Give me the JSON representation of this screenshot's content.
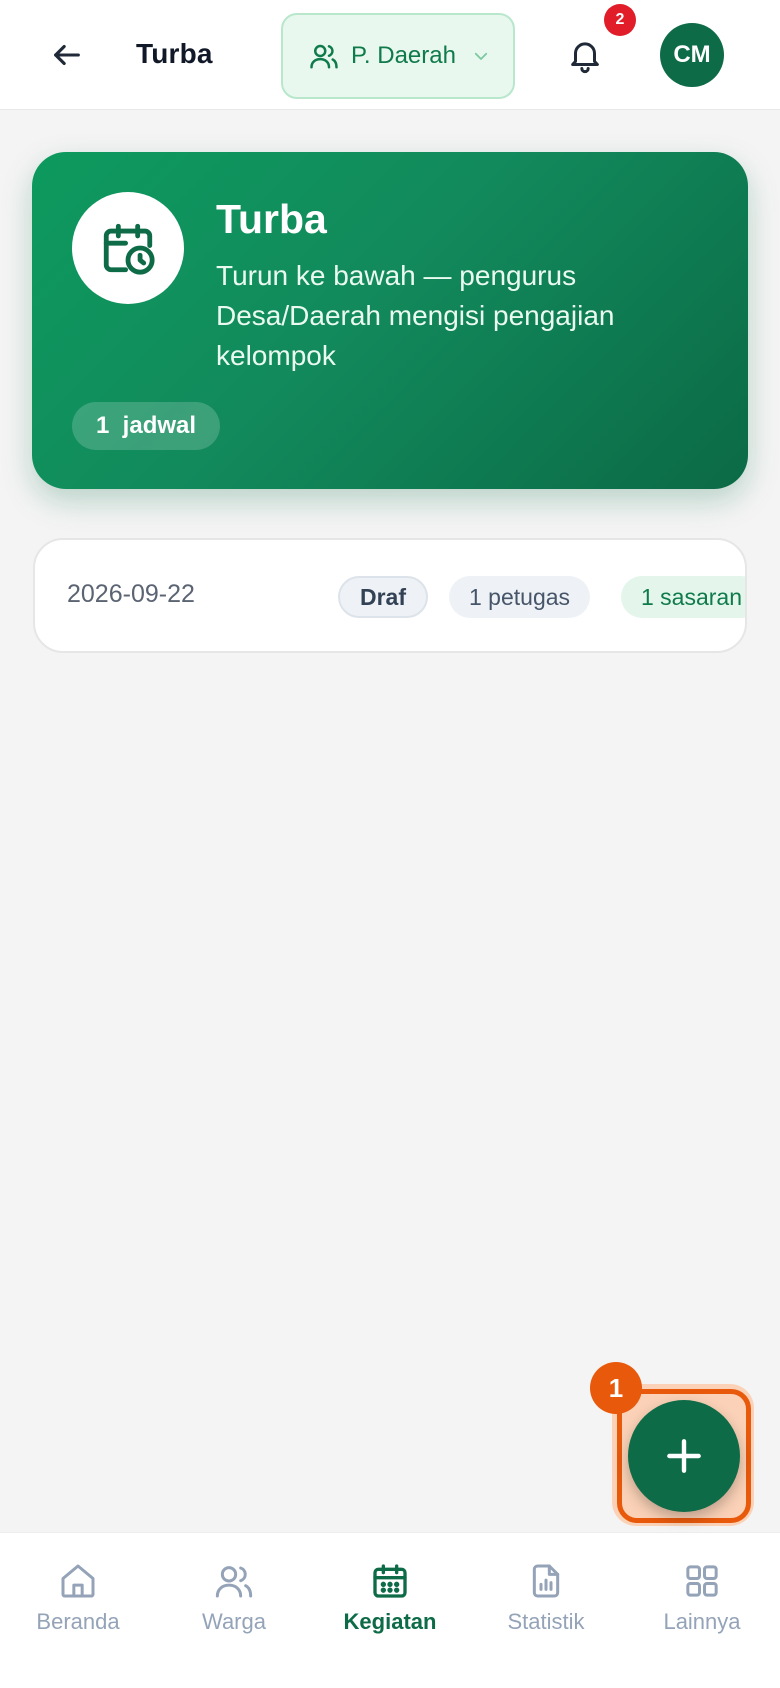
{
  "header": {
    "title": "Turba",
    "region_label": "P. Daerah",
    "notification_count": "2",
    "avatar_initials": "CM"
  },
  "hero": {
    "title": "Turba",
    "description": "Turun ke bawah — pengurus Desa/Daerah mengisi pengajian kelompok",
    "chip_label": "1  jadwal"
  },
  "schedules": [
    {
      "date": "2026-09-22",
      "status": "Draf",
      "petugas": "1 petugas",
      "sasaran": "1 sasaran"
    }
  ],
  "fab": {
    "marker": "1",
    "icon": "plus-icon"
  },
  "bottom_nav": {
    "items": [
      {
        "label": "Beranda",
        "icon": "home-icon"
      },
      {
        "label": "Warga",
        "icon": "users-icon"
      },
      {
        "label": "Kegiatan",
        "icon": "calendar-icon",
        "active": true
      },
      {
        "label": "Statistik",
        "icon": "report-chart-icon"
      },
      {
        "label": "Lainnya",
        "icon": "grid-icon"
      }
    ]
  },
  "colors": {
    "primary": "#0e6b48",
    "hero_gradient_start": "#0d9a5e",
    "badge_red": "#e11d2a",
    "marker_orange": "#e8590c"
  }
}
